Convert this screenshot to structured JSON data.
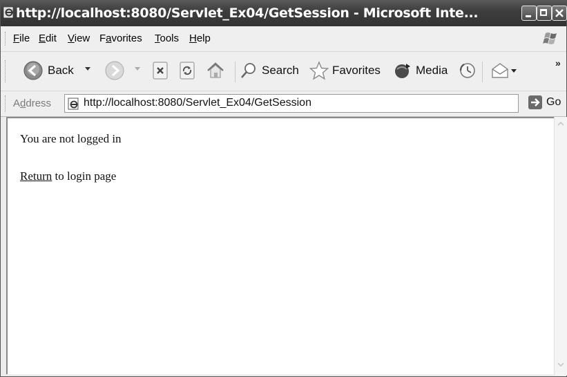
{
  "window": {
    "title": "http://localhost:8080/Servlet_Ex04/GetSession - Microsoft Inte..."
  },
  "menu": {
    "file": {
      "accel": "F",
      "rest": "ile"
    },
    "edit": {
      "accel": "E",
      "rest": "dit"
    },
    "view": {
      "accel": "V",
      "rest": "iew"
    },
    "favorites": {
      "pre": "F",
      "accel": "a",
      "rest": "vorites"
    },
    "tools": {
      "accel": "T",
      "rest": "ools"
    },
    "help": {
      "accel": "H",
      "rest": "elp"
    }
  },
  "toolbar": {
    "back_label": "Back",
    "search_label": "Search",
    "favorites_label": "Favorites",
    "media_label": "Media",
    "more_label": "»"
  },
  "address": {
    "label_pre": "A",
    "label_accel": "d",
    "label_rest": "dress",
    "value": "http://localhost:8080/Servlet_Ex04/GetSession",
    "go_label": "Go"
  },
  "content": {
    "message": "You are not logged in",
    "return_link": "Return",
    "return_suffix": " to login page"
  },
  "icons": {
    "app": "ie-page-icon",
    "minimize": "minimize-icon",
    "maximize": "maximize-icon",
    "close": "close-icon",
    "windows_flag": "windows-flag-icon",
    "back": "back-arrow-icon",
    "forward": "forward-arrow-icon",
    "stop": "stop-icon",
    "refresh": "refresh-icon",
    "home": "home-icon",
    "search": "search-icon",
    "favorites": "star-icon",
    "media": "media-icon",
    "history": "history-icon",
    "mail": "mail-icon",
    "go": "go-arrow-icon"
  }
}
